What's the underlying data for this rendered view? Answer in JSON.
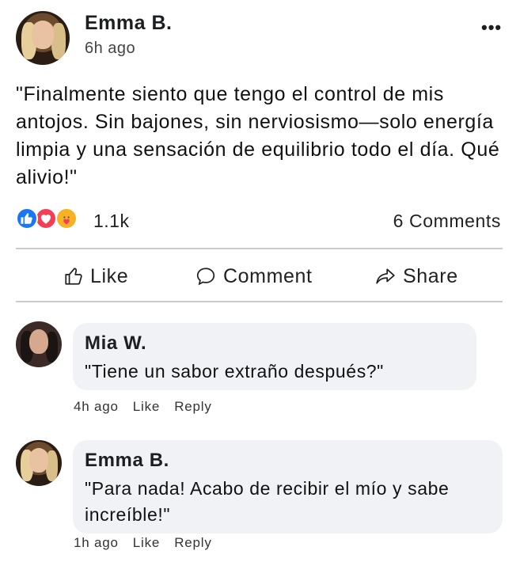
{
  "post": {
    "author": "Emma B.",
    "time": "6h ago",
    "more_label": "•••",
    "text": "\"Finalmente siento que tengo el control de mis antojos. Sin bajones, sin nerviosismo—solo energía limpia y una sensación de equilibrio todo el día. Qué alivio!\"",
    "reactions": {
      "icons": [
        "like-icon",
        "love-icon",
        "care-icon"
      ],
      "count": "1.1k"
    },
    "comment_count": "6 Comments"
  },
  "actions": {
    "like": "Like",
    "comment": "Comment",
    "share": "Share"
  },
  "comments": [
    {
      "name": "Mia W.",
      "text": "\"Tiene un sabor extraño después?\"",
      "time": "4h ago",
      "like": "Like",
      "reply": "Reply"
    },
    {
      "name": "Emma B.",
      "text": "\"Para nada! Acabo de recibir el mío y sabe increíble!\"",
      "time": "1h ago",
      "like": "Like",
      "reply": "Reply"
    }
  ],
  "colors": {
    "like_blue": "#1877f2",
    "love_red": "#f33e58",
    "care_yellow": "#f7b125",
    "bubble_bg": "#f0f2f5",
    "divider": "#c8ccd1"
  }
}
